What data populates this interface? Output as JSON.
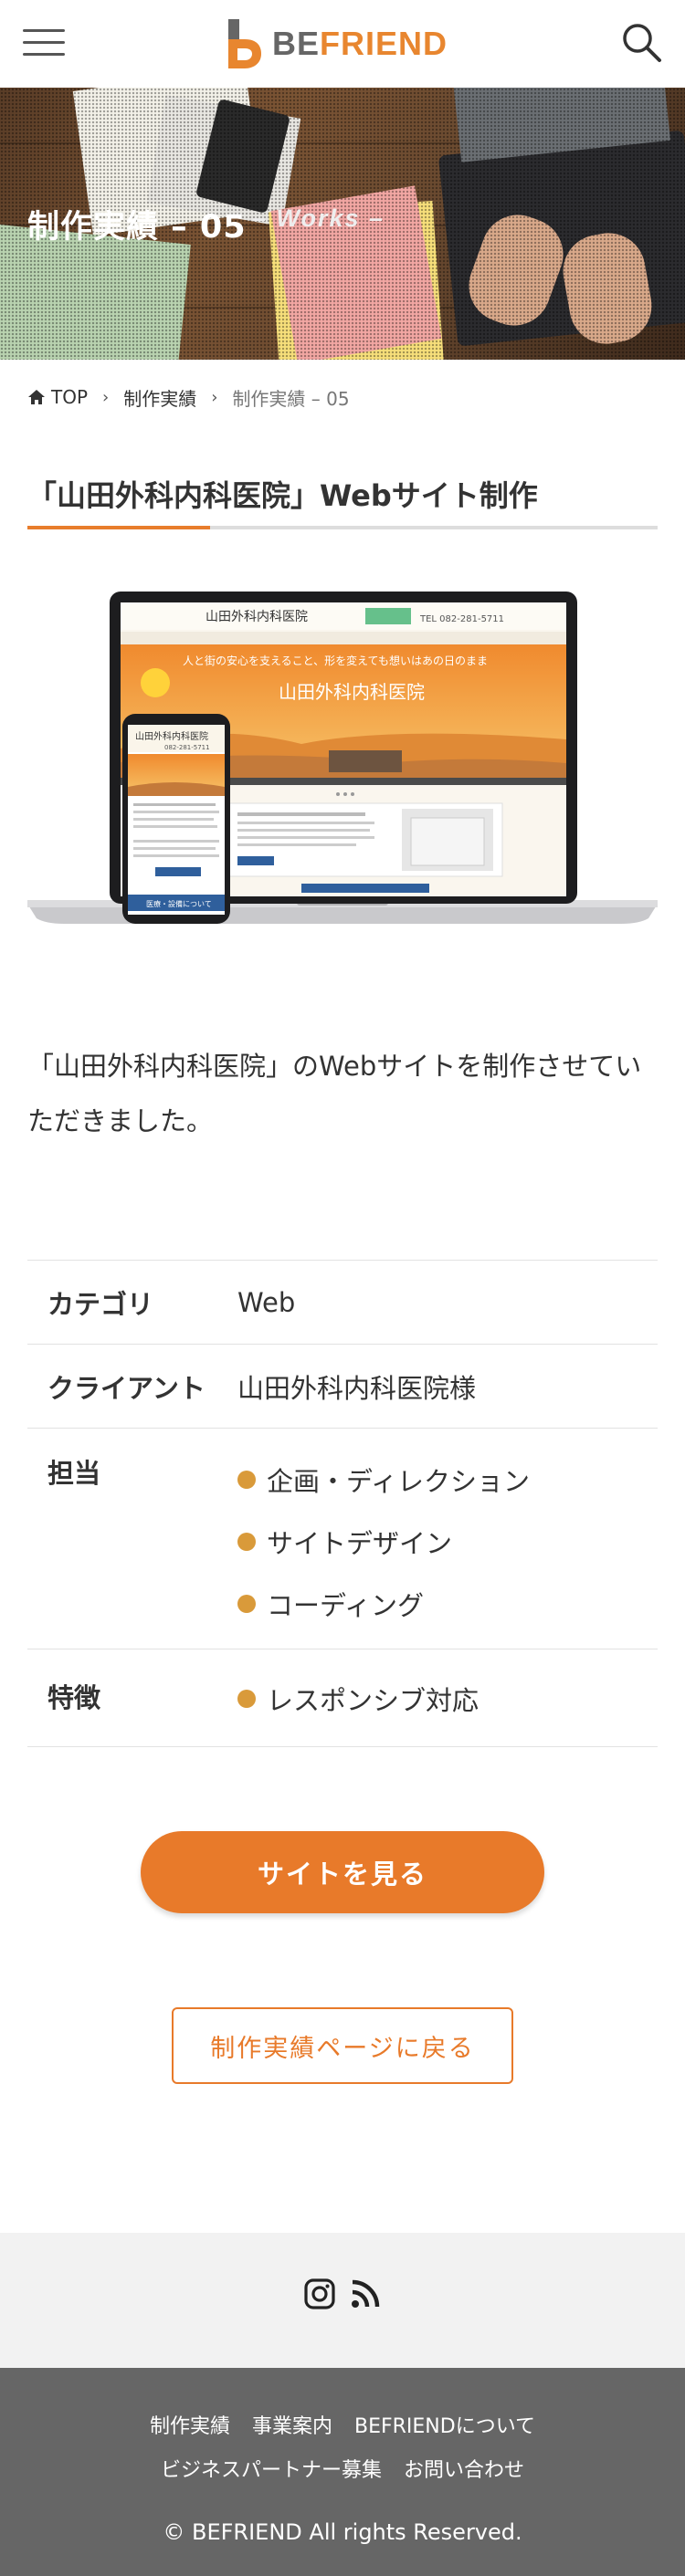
{
  "header": {
    "logo_be": "BE",
    "logo_friend": "FRIEND",
    "menu_icon": "hamburger-menu-icon",
    "search_icon": "search-icon"
  },
  "hero": {
    "title": "制作実績 – 05",
    "subtitle": "– Works –"
  },
  "breadcrumb": {
    "home": "TOP",
    "level1": "制作実績",
    "current": "制作実績 – 05"
  },
  "page_title": "「山田外科内科医院」Webサイト制作",
  "mockup": {
    "clinic_name": "山田外科内科医院",
    "tagline": "人と街の安心を支えること、形を変えても想いはあの日のまま",
    "phone": "TEL 082-281-5711",
    "phone_sp": "082-281-5711",
    "button": "医療・設備について"
  },
  "description": "「山田外科内科医院」のWebサイトを制作させていただきました。",
  "info": {
    "category_label": "カテゴリ",
    "category_value": "Web",
    "client_label": "クライアント",
    "client_value": "山田外科内科医院様",
    "tantou_label": "担当",
    "tantou_items": [
      "企画・ディレクション",
      "サイトデザイン",
      "コーディング"
    ],
    "tokucho_label": "特徴",
    "tokucho_items": [
      "レスポンシブ対応"
    ]
  },
  "buttons": {
    "view_site": "サイトを見る",
    "back": "制作実績ページに戻る"
  },
  "social": {
    "instagram": "instagram-icon",
    "rss": "rss-icon"
  },
  "footer": {
    "links_row1": [
      "制作実績",
      "事業案内",
      "BEFRIENDについて"
    ],
    "links_row2": [
      "ビジネスパートナー募集",
      "お問い合わせ"
    ],
    "copyright": "© BEFRIEND All rights Reserved."
  },
  "colors": {
    "accent": "#e87a2a",
    "bullet": "#d99a3a",
    "footer_bg": "#666666"
  }
}
